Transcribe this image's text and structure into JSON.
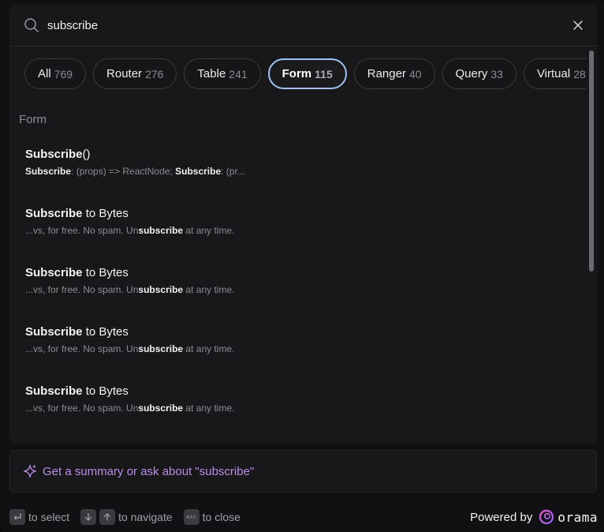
{
  "search": {
    "value": "subscribe",
    "placeholder": ""
  },
  "tabs": [
    {
      "label": "All",
      "count": "769",
      "active": false
    },
    {
      "label": "Router",
      "count": "276",
      "active": false
    },
    {
      "label": "Table",
      "count": "241",
      "active": false
    },
    {
      "label": "Form",
      "count": "115",
      "active": true
    },
    {
      "label": "Ranger",
      "count": "40",
      "active": false
    },
    {
      "label": "Query",
      "count": "33",
      "active": false
    },
    {
      "label": "Virtual",
      "count": "28",
      "active": false
    }
  ],
  "group": {
    "label": "Form"
  },
  "results": [
    {
      "title_bold": "Subscribe",
      "title_rest": "()",
      "snippet": [
        {
          "t": "Subscribe",
          "b": true
        },
        {
          "t": ": (props) => ReactNode; ",
          "b": false
        },
        {
          "t": "Subscribe",
          "b": true
        },
        {
          "t": ": (pr...",
          "b": false
        }
      ]
    },
    {
      "title_bold": "Subscribe",
      "title_rest": " to Bytes",
      "snippet": [
        {
          "t": "...vs, for free. No spam. Un",
          "b": false
        },
        {
          "t": "subscribe",
          "b": true
        },
        {
          "t": " at any time.",
          "b": false
        }
      ]
    },
    {
      "title_bold": "Subscribe",
      "title_rest": " to Bytes",
      "snippet": [
        {
          "t": "...vs, for free. No spam. Un",
          "b": false
        },
        {
          "t": "subscribe",
          "b": true
        },
        {
          "t": " at any time.",
          "b": false
        }
      ]
    },
    {
      "title_bold": "Subscribe",
      "title_rest": " to Bytes",
      "snippet": [
        {
          "t": "...vs, for free. No spam. Un",
          "b": false
        },
        {
          "t": "subscribe",
          "b": true
        },
        {
          "t": " at any time.",
          "b": false
        }
      ]
    },
    {
      "title_bold": "Subscribe",
      "title_rest": " to Bytes",
      "snippet": [
        {
          "t": "...vs, for free. No spam. Un",
          "b": false
        },
        {
          "t": "subscribe",
          "b": true
        },
        {
          "t": " at any time.",
          "b": false
        }
      ]
    }
  ],
  "ask": {
    "label": "Get a summary or ask about \"subscribe\""
  },
  "footer": {
    "select_hint": "to select",
    "navigate_hint": "to navigate",
    "esc_key": "esc",
    "close_hint": "to close",
    "powered_by": "Powered by",
    "brand": "orama"
  },
  "colors": {
    "accent_active_border": "#9ec3f0",
    "ask_purple": "#b98ee6"
  }
}
